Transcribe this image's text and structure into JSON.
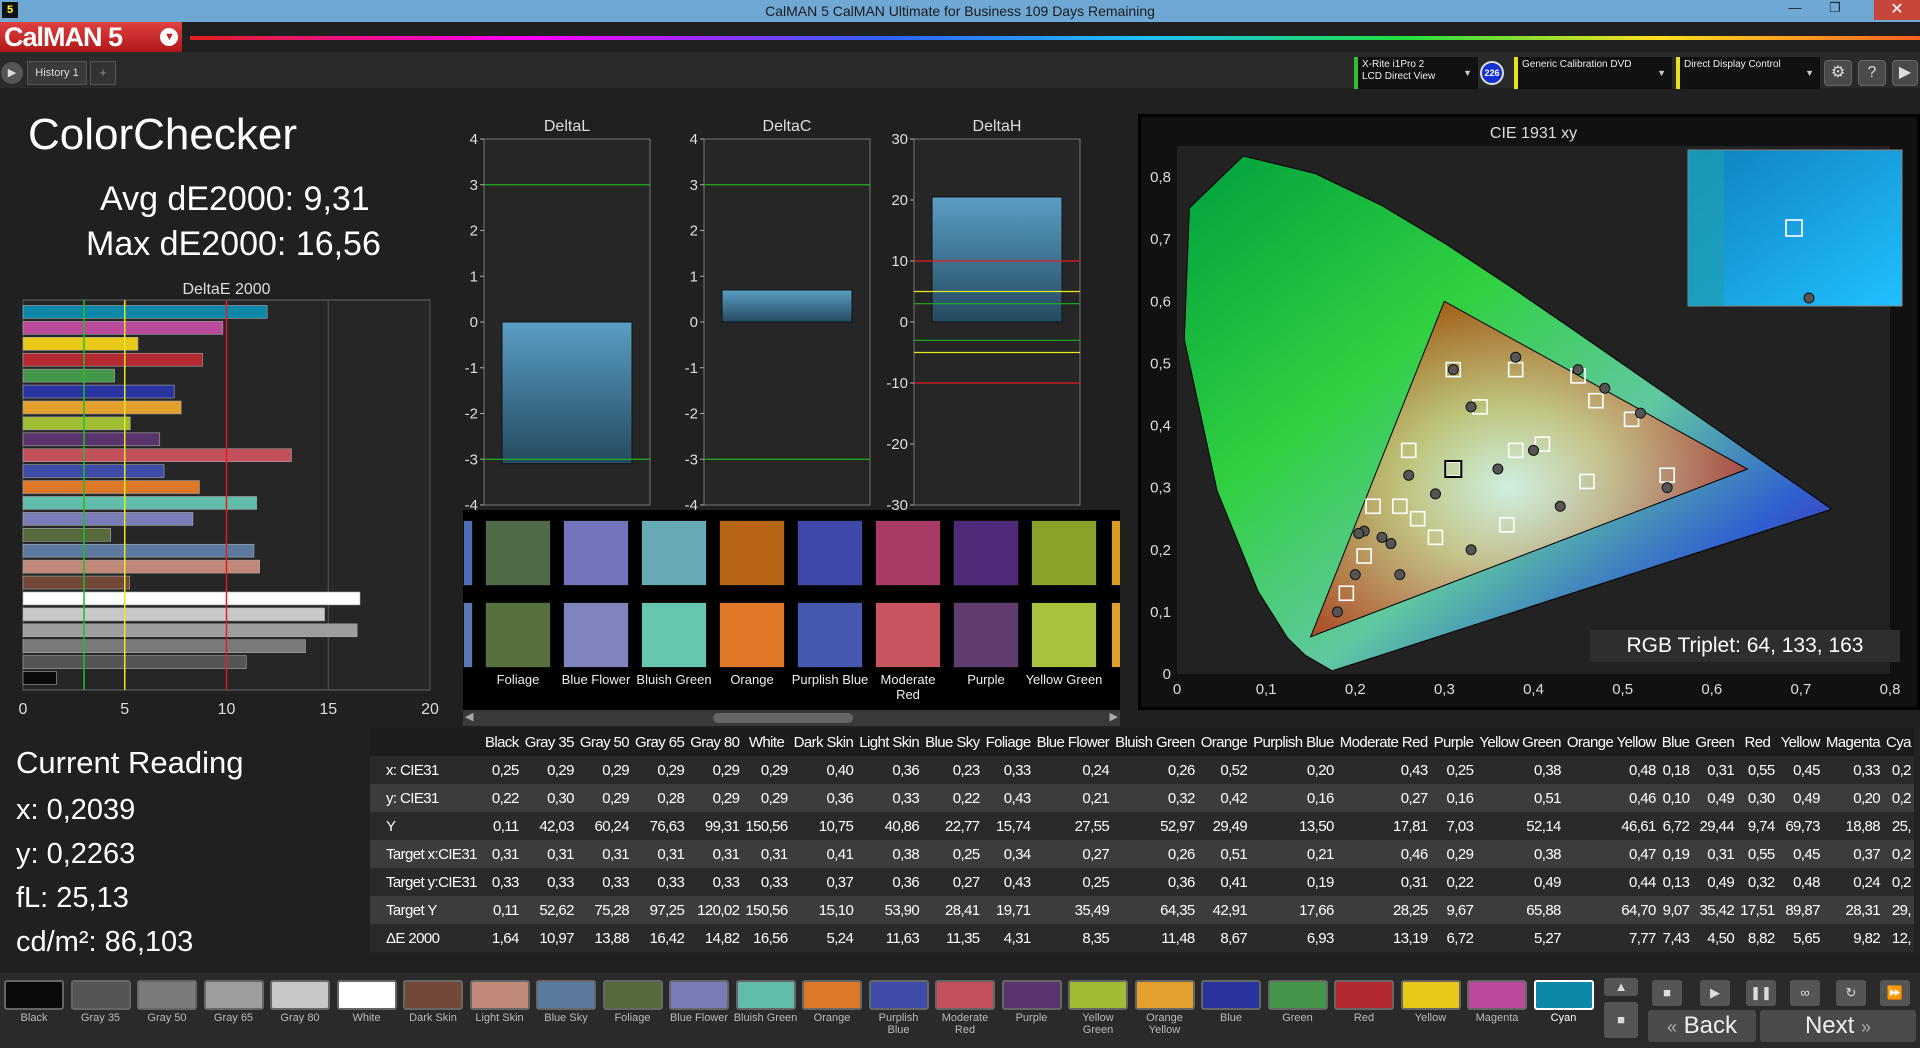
{
  "window": {
    "title": "CalMAN 5 CalMAN Ultimate for Business 109 Days Remaining",
    "app_icon": "5",
    "logo": "CalMAN 5"
  },
  "tabs": {
    "history": "History 1",
    "plus": "+"
  },
  "devices": [
    {
      "line1": "X-Rite i1Pro 2",
      "line2": "LCD Direct View",
      "color": "#30c030"
    },
    {
      "line1": "Generic Calibration DVD",
      "line2": "",
      "color": "#e8e020"
    },
    {
      "line1": "Direct Display Control",
      "line2": "",
      "color": "#e8e020"
    }
  ],
  "device_badge": "226",
  "left": {
    "title": "ColorChecker",
    "avg": "Avg dE2000: 9,31",
    "max": "Max dE2000: 16,56",
    "chart_title": "DeltaE 2000",
    "current_title": "Current Reading",
    "x": "x: 0,2039",
    "y": "y: 0,2263",
    "fl": "fL: 25,13",
    "cdm": "cd/m²: 86,103"
  },
  "delta_titles": {
    "l": "DeltaL",
    "c": "DeltaC",
    "h": "DeltaH"
  },
  "cie": {
    "title": "CIE 1931 xy",
    "rgb_triplet": "RGB Triplet: 64, 133, 163"
  },
  "chart_data": [
    {
      "type": "bar",
      "title": "DeltaE 2000",
      "orientation": "horizontal",
      "xlim": [
        0,
        20
      ],
      "xticks": [
        0,
        5,
        10,
        15,
        20
      ],
      "reference_lines": [
        3,
        5,
        10
      ],
      "categories": [
        "Black",
        "Gray 35",
        "Gray 50",
        "Gray 65",
        "Gray 80",
        "White",
        "Dark Skin",
        "Light Skin",
        "Blue Sky",
        "Foliage",
        "Blue Flower",
        "Bluish Green",
        "Orange",
        "Purplish Blue",
        "Moderate Red",
        "Purple",
        "Yellow Green",
        "Orange Yellow",
        "Blue",
        "Green",
        "Red",
        "Yellow",
        "Magenta",
        "Cyan"
      ],
      "values": [
        1.64,
        10.97,
        13.88,
        16.42,
        14.82,
        16.56,
        5.24,
        11.63,
        11.35,
        4.31,
        8.35,
        11.48,
        8.67,
        6.93,
        13.19,
        6.72,
        5.27,
        7.77,
        7.43,
        4.5,
        8.82,
        5.65,
        9.82,
        12.0
      ]
    },
    {
      "type": "bar",
      "title": "DeltaL",
      "ylim": [
        -4,
        4
      ],
      "yticks": [
        4,
        3,
        2,
        1,
        0,
        -1,
        -2,
        -3,
        -4
      ],
      "values": [
        -3.1
      ]
    },
    {
      "type": "bar",
      "title": "DeltaC",
      "ylim": [
        -4,
        4
      ],
      "yticks": [
        4,
        3,
        2,
        1,
        0,
        -1,
        -2,
        -3,
        -4
      ],
      "values": [
        0.7
      ]
    },
    {
      "type": "bar",
      "title": "DeltaH",
      "ylim": [
        -30,
        30
      ],
      "yticks": [
        30,
        20,
        10,
        0,
        -10,
        -20,
        -30
      ],
      "values": [
        20.5
      ]
    },
    {
      "type": "scatter",
      "title": "CIE 1931 xy",
      "xlim": [
        0,
        0.8
      ],
      "ylim": [
        0,
        0.85
      ],
      "xticks": [
        "0",
        "0,1",
        "0,2",
        "0,3",
        "0,4",
        "0,5",
        "0,6",
        "0,7",
        "0,8"
      ],
      "yticks": [
        "0",
        "0,1",
        "0,2",
        "0,3",
        "0,4",
        "0,5",
        "0,6",
        "0,7",
        "0,8"
      ],
      "targets": [
        [
          0.31,
          0.33
        ],
        [
          0.41,
          0.37
        ],
        [
          0.38,
          0.36
        ],
        [
          0.25,
          0.27
        ],
        [
          0.34,
          0.43
        ],
        [
          0.27,
          0.25
        ],
        [
          0.26,
          0.36
        ],
        [
          0.51,
          0.41
        ],
        [
          0.21,
          0.19
        ],
        [
          0.46,
          0.31
        ],
        [
          0.29,
          0.22
        ],
        [
          0.38,
          0.49
        ],
        [
          0.47,
          0.44
        ],
        [
          0.19,
          0.13
        ],
        [
          0.31,
          0.49
        ],
        [
          0.55,
          0.32
        ],
        [
          0.45,
          0.48
        ],
        [
          0.37,
          0.24
        ],
        [
          0.22,
          0.27
        ]
      ],
      "measured": [
        [
          0.29,
          0.29
        ],
        [
          0.4,
          0.36
        ],
        [
          0.36,
          0.33
        ],
        [
          0.23,
          0.22
        ],
        [
          0.33,
          0.43
        ],
        [
          0.24,
          0.21
        ],
        [
          0.26,
          0.32
        ],
        [
          0.52,
          0.42
        ],
        [
          0.2,
          0.16
        ],
        [
          0.43,
          0.27
        ],
        [
          0.25,
          0.16
        ],
        [
          0.38,
          0.51
        ],
        [
          0.48,
          0.46
        ],
        [
          0.18,
          0.1
        ],
        [
          0.31,
          0.49
        ],
        [
          0.55,
          0.3
        ],
        [
          0.45,
          0.49
        ],
        [
          0.33,
          0.2
        ],
        [
          0.21,
          0.23
        ],
        [
          0.2039,
          0.2263
        ]
      ]
    }
  ],
  "patches_top": [
    {
      "name": "Foliage",
      "color": "#516a48"
    },
    {
      "name": "Blue Flower",
      "color": "#7474be"
    },
    {
      "name": "Bluish Green",
      "color": "#66aab6"
    },
    {
      "name": "Orange",
      "color": "#b86516"
    },
    {
      "name": "Purplish Blue",
      "color": "#3e49aa"
    },
    {
      "name": "Moderate Red",
      "color": "#a83a66"
    },
    {
      "name": "Purple",
      "color": "#4e2a78"
    },
    {
      "name": "Yellow Green",
      "color": "#8aa228"
    }
  ],
  "patches_bottom": [
    {
      "name": "Foliage",
      "color": "#56703e"
    },
    {
      "name": "Blue Flower",
      "color": "#8084be"
    },
    {
      "name": "Bluish Green",
      "color": "#66c6b0"
    },
    {
      "name": "Orange",
      "color": "#e07828"
    },
    {
      "name": "Purplish Blue",
      "color": "#4658b0"
    },
    {
      "name": "Moderate Red",
      "color": "#c85460"
    },
    {
      "name": "Purple",
      "color": "#5e3c70"
    },
    {
      "name": "Yellow Green",
      "color": "#a8c240"
    }
  ],
  "table": {
    "headers": [
      "Black",
      "Gray 35",
      "Gray 50",
      "Gray 65",
      "Gray 80",
      "White",
      "Dark Skin",
      "Light Skin",
      "Blue Sky",
      "Foliage",
      "Blue Flower",
      "Bluish Green",
      "Orange",
      "Purplish Blue",
      "Moderate Red",
      "Purple",
      "Yellow Green",
      "Orange Yellow",
      "Blue",
      "Green",
      "Red",
      "Yellow",
      "Magenta",
      "Cya"
    ],
    "rows": [
      {
        "label": "x: CIE31",
        "values": [
          "0,25",
          "0,29",
          "0,29",
          "0,29",
          "0,29",
          "0,29",
          "0,40",
          "0,36",
          "0,23",
          "0,33",
          "0,24",
          "0,26",
          "0,52",
          "0,20",
          "0,43",
          "0,25",
          "0,38",
          "0,48",
          "0,18",
          "0,31",
          "0,55",
          "0,45",
          "0,33",
          "0,2"
        ]
      },
      {
        "label": "y: CIE31",
        "values": [
          "0,22",
          "0,30",
          "0,29",
          "0,28",
          "0,29",
          "0,29",
          "0,36",
          "0,33",
          "0,22",
          "0,43",
          "0,21",
          "0,32",
          "0,42",
          "0,16",
          "0,27",
          "0,16",
          "0,51",
          "0,46",
          "0,10",
          "0,49",
          "0,30",
          "0,49",
          "0,20",
          "0,2"
        ]
      },
      {
        "label": "Y",
        "values": [
          "0,11",
          "42,03",
          "60,24",
          "76,63",
          "99,31",
          "150,56",
          "10,75",
          "40,86",
          "22,77",
          "15,74",
          "27,55",
          "52,97",
          "29,49",
          "13,50",
          "17,81",
          "7,03",
          "52,14",
          "46,61",
          "6,72",
          "29,44",
          "9,74",
          "69,73",
          "18,88",
          "25,"
        ]
      },
      {
        "label": "Target x:CIE31",
        "values": [
          "0,31",
          "0,31",
          "0,31",
          "0,31",
          "0,31",
          "0,31",
          "0,41",
          "0,38",
          "0,25",
          "0,34",
          "0,27",
          "0,26",
          "0,51",
          "0,21",
          "0,46",
          "0,29",
          "0,38",
          "0,47",
          "0,19",
          "0,31",
          "0,55",
          "0,45",
          "0,37",
          "0,2"
        ]
      },
      {
        "label": "Target y:CIE31",
        "values": [
          "0,33",
          "0,33",
          "0,33",
          "0,33",
          "0,33",
          "0,33",
          "0,37",
          "0,36",
          "0,27",
          "0,43",
          "0,25",
          "0,36",
          "0,41",
          "0,19",
          "0,31",
          "0,22",
          "0,49",
          "0,44",
          "0,13",
          "0,49",
          "0,32",
          "0,48",
          "0,24",
          "0,2"
        ]
      },
      {
        "label": "Target Y",
        "values": [
          "0,11",
          "52,62",
          "75,28",
          "97,25",
          "120,02",
          "150,56",
          "15,10",
          "53,90",
          "28,41",
          "19,71",
          "35,49",
          "64,35",
          "42,91",
          "17,66",
          "28,25",
          "9,67",
          "65,88",
          "64,70",
          "9,07",
          "35,42",
          "17,51",
          "89,87",
          "28,31",
          "29,"
        ]
      },
      {
        "label": "ΔE 2000",
        "values": [
          "1,64",
          "10,97",
          "13,88",
          "16,42",
          "14,82",
          "16,56",
          "5,24",
          "11,63",
          "11,35",
          "4,31",
          "8,35",
          "11,48",
          "8,67",
          "6,93",
          "13,19",
          "6,72",
          "5,27",
          "7,77",
          "7,43",
          "4,50",
          "8,82",
          "5,65",
          "9,82",
          "12,"
        ]
      }
    ]
  },
  "swatches": [
    {
      "name": "Black",
      "color": "#0a0a0a"
    },
    {
      "name": "Gray 35",
      "color": "#555555"
    },
    {
      "name": "Gray 50",
      "color": "#7a7a7a"
    },
    {
      "name": "Gray 65",
      "color": "#9e9e9e"
    },
    {
      "name": "Gray 80",
      "color": "#c8c8c8"
    },
    {
      "name": "White",
      "color": "#ffffff"
    },
    {
      "name": "Dark Skin",
      "color": "#744838"
    },
    {
      "name": "Light Skin",
      "color": "#c08878"
    },
    {
      "name": "Blue Sky",
      "color": "#5c7aa0"
    },
    {
      "name": "Foliage",
      "color": "#566a3c"
    },
    {
      "name": "Blue Flower",
      "color": "#7a7cb8"
    },
    {
      "name": "Bluish Green",
      "color": "#62bcaa"
    },
    {
      "name": "Orange",
      "color": "#dc7828"
    },
    {
      "name": "Purplish Blue",
      "color": "#3e4ca8"
    },
    {
      "name": "Moderate Red",
      "color": "#c4505c"
    },
    {
      "name": "Purple",
      "color": "#5a346c"
    },
    {
      "name": "Yellow Green",
      "color": "#a0bc34"
    },
    {
      "name": "Orange Yellow",
      "color": "#e4a02c"
    },
    {
      "name": "Blue",
      "color": "#2a34a0"
    },
    {
      "name": "Green",
      "color": "#44964a"
    },
    {
      "name": "Red",
      "color": "#b42830"
    },
    {
      "name": "Yellow",
      "color": "#e8c818"
    },
    {
      "name": "Magenta",
      "color": "#bc4a9c"
    },
    {
      "name": "Cyan",
      "color": "#0e88a8"
    }
  ],
  "nav": {
    "back": "Back",
    "next": "Next"
  }
}
